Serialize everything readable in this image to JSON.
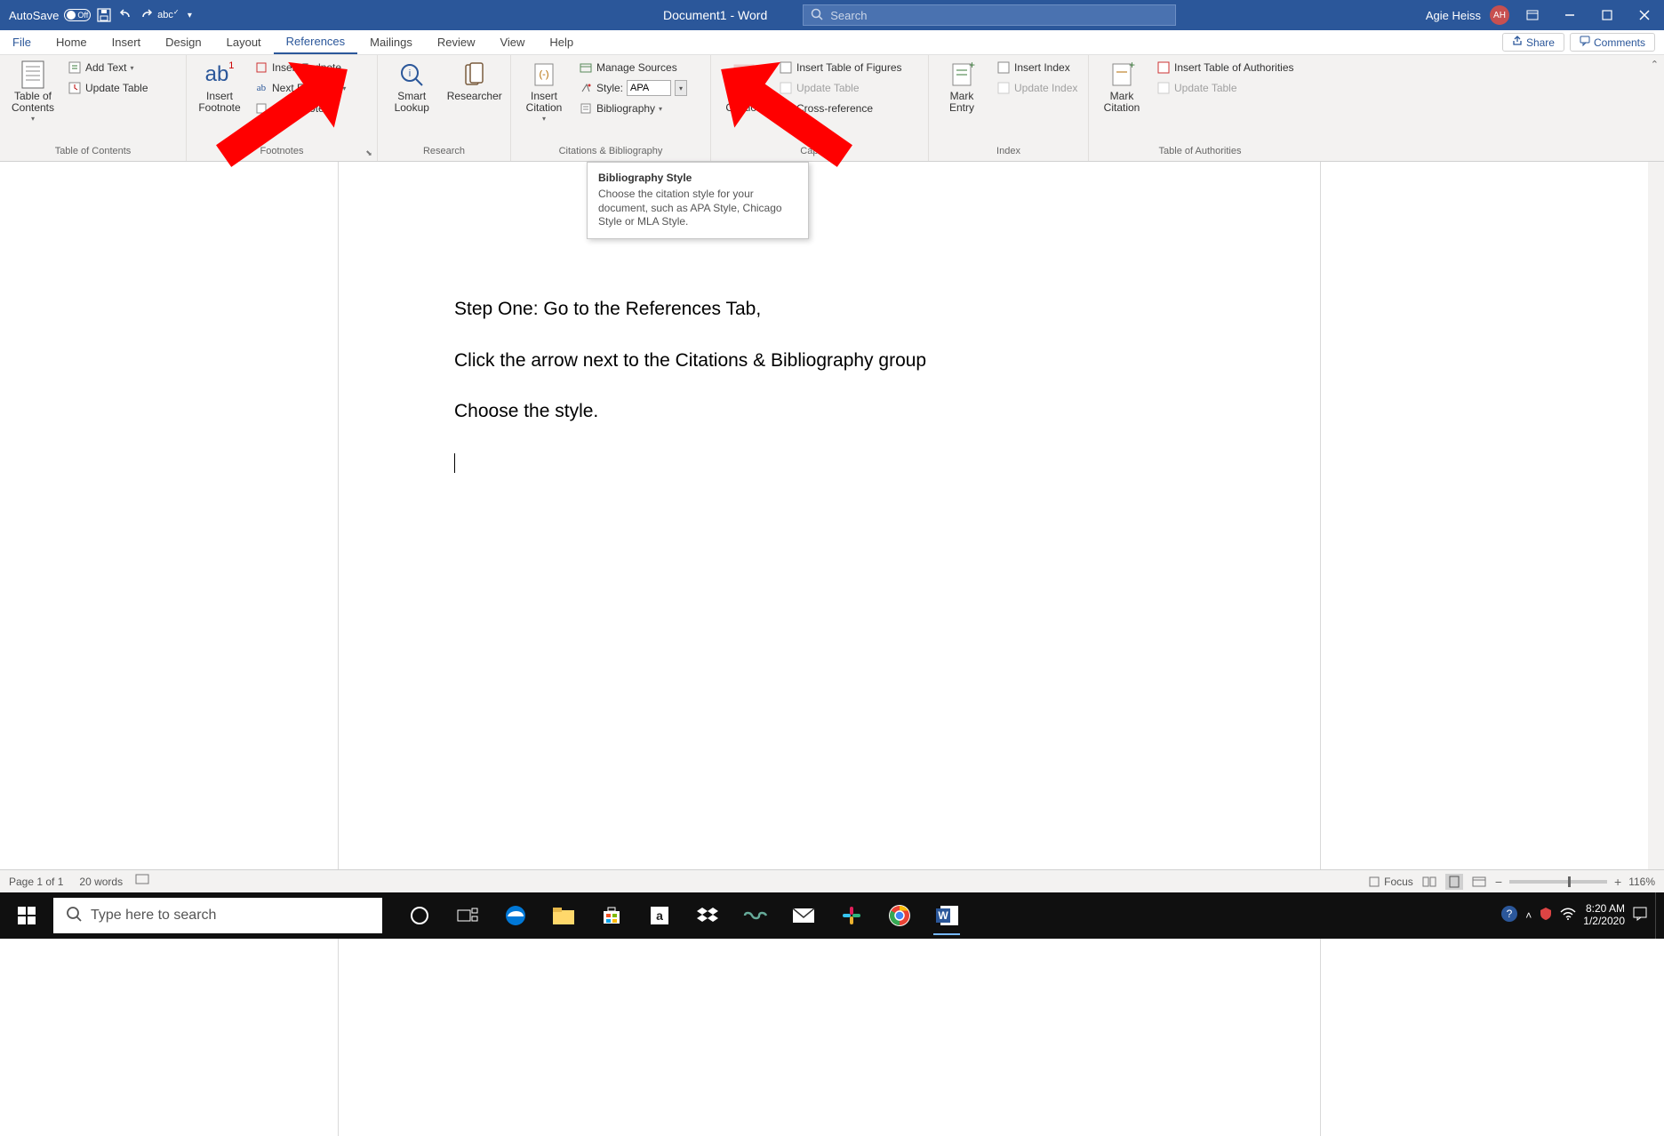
{
  "titlebar": {
    "autosave_label": "AutoSave",
    "autosave_state": "Off",
    "doc_title": "Document1 - Word",
    "search_placeholder": "Search",
    "user_name": "Agie Heiss",
    "user_initials": "AH"
  },
  "tabs": {
    "file": "File",
    "items": [
      "Home",
      "Insert",
      "Design",
      "Layout",
      "References",
      "Mailings",
      "Review",
      "View",
      "Help"
    ],
    "active_index": 4,
    "share": "Share",
    "comments": "Comments"
  },
  "ribbon": {
    "groups": {
      "toc": {
        "label": "Table of Contents",
        "big": "Table of\nContents",
        "add_text": "Add Text",
        "update_table": "Update Table"
      },
      "footnotes": {
        "label": "Footnotes",
        "big": "Insert\nFootnote",
        "insert_endnote": "Insert Endnote",
        "next_footnote": "Next Footnote",
        "show_notes": "Show Notes",
        "ab": "ab",
        "ab_sup": "1"
      },
      "research": {
        "label": "Research",
        "smart": "Smart\nLookup",
        "researcher": "Researcher"
      },
      "citations": {
        "label": "Citations & Bibliography",
        "big": "Insert\nCitation",
        "manage_sources": "Manage Sources",
        "style_label": "Style:",
        "style_value": "APA",
        "bibliography": "Bibliography"
      },
      "captions": {
        "label": "Captions",
        "big": "Insert\nCaption",
        "insert_tof": "Insert Table of Figures",
        "update_table": "Update Table",
        "cross_ref": "Cross-reference"
      },
      "index": {
        "label": "Index",
        "big": "Mark\nEntry",
        "insert_index": "Insert Index",
        "update_index": "Update Index"
      },
      "toa": {
        "label": "Table of Authorities",
        "big": "Mark\nCitation",
        "insert_toa": "Insert Table of Authorities",
        "update_table": "Update Table"
      }
    }
  },
  "tooltip": {
    "title": "Bibliography Style",
    "body": "Choose the citation style for your document, such as APA Style, Chicago Style or MLA Style."
  },
  "document": {
    "p1": "Step One: Go to the References Tab,",
    "p2": "Click the arrow next to the Citations & Bibliography group",
    "p3": "Choose the style."
  },
  "statusbar": {
    "page": "Page 1 of 1",
    "words": "20 words",
    "focus": "Focus",
    "zoom": "116%"
  },
  "taskbar": {
    "search_placeholder": "Type here to search",
    "time": "8:20 AM",
    "date": "1/2/2020"
  }
}
